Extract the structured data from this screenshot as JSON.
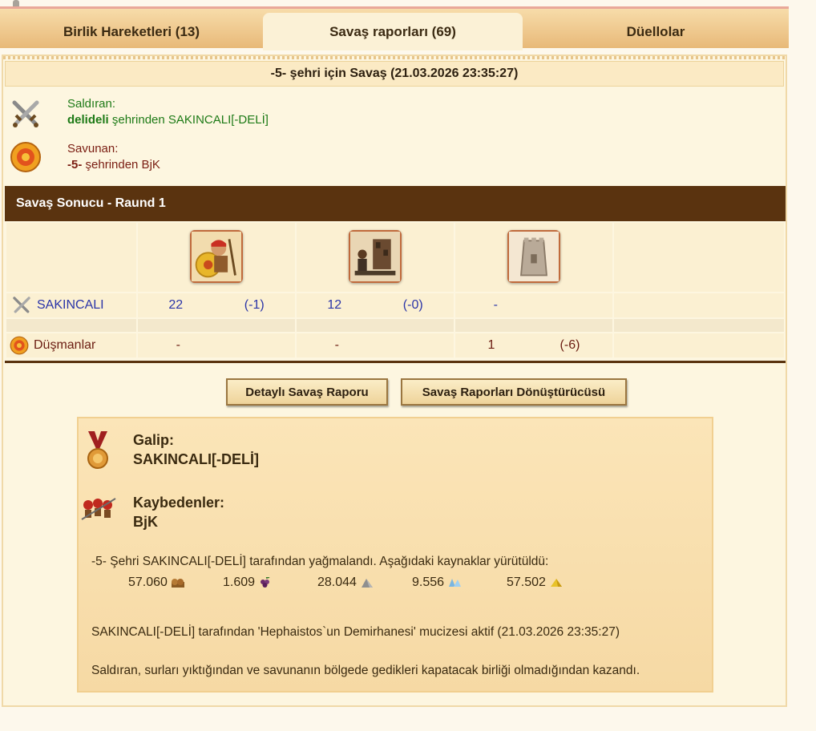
{
  "tabs": [
    {
      "label": "Birlik Hareketleri (13)"
    },
    {
      "label": "Savaş raporları (69)"
    },
    {
      "label": "Düellolar"
    }
  ],
  "report": {
    "title": "-5- şehri için Savaş (21.03.2026 23:35:27)",
    "attacker_label": "Saldıran:",
    "attacker_city": "delideli",
    "attacker_suffix": " şehrinden SAKINCALI[-DELİ]",
    "defender_label": "Savunan:",
    "defender_city": "-5-",
    "defender_suffix": " şehrinden BjK"
  },
  "round": {
    "title": "Savaş Sonucu - Raund 1"
  },
  "units": {
    "columns": [
      {
        "icon": "hoplite-unit-icon"
      },
      {
        "icon": "catapult-unit-icon"
      },
      {
        "icon": "city-wall-icon"
      }
    ],
    "rows": [
      {
        "name": "SAKINCALI",
        "cells": [
          {
            "value": "22",
            "loss": "(-1)"
          },
          {
            "value": "12",
            "loss": "(-0)"
          },
          {
            "value": "-",
            "loss": ""
          }
        ]
      },
      {
        "name": "Düşmanlar",
        "cells": [
          {
            "value": "-",
            "loss": ""
          },
          {
            "value": "-",
            "loss": ""
          },
          {
            "value": "1",
            "loss": "(-6)"
          }
        ]
      }
    ]
  },
  "buttons": {
    "detailed": "Detaylı Savaş Raporu",
    "converter": "Savaş Raporları Dönüştürücüsü"
  },
  "result": {
    "winner_label": "Galip:",
    "winner": "SAKINCALI[-DELİ]",
    "losers_label": "Kaybedenler:",
    "losers": "BjK",
    "plunder_text": "-5- Şehri SAKINCALI[-DELİ] tarafından yağmalandı. Aşağıdaki kaynaklar yürütüldü:",
    "resources": [
      {
        "amount": "57.060",
        "icon": "wood-icon"
      },
      {
        "amount": "1.609",
        "icon": "wine-icon"
      },
      {
        "amount": "28.044",
        "icon": "marble-icon"
      },
      {
        "amount": "9.556",
        "icon": "crystal-icon"
      },
      {
        "amount": "57.502",
        "icon": "sulfur-icon"
      }
    ],
    "wonder_text": "SAKINCALI[-DELİ] tarafından 'Hephaistos`un Demirhanesi' mucizesi aktif (21.03.2026 23:35:27)",
    "reason_text": "Saldıran, surları yıktığından ve savunanın bölgede gedikleri kapatacak birliği olmadığından kazandı."
  }
}
